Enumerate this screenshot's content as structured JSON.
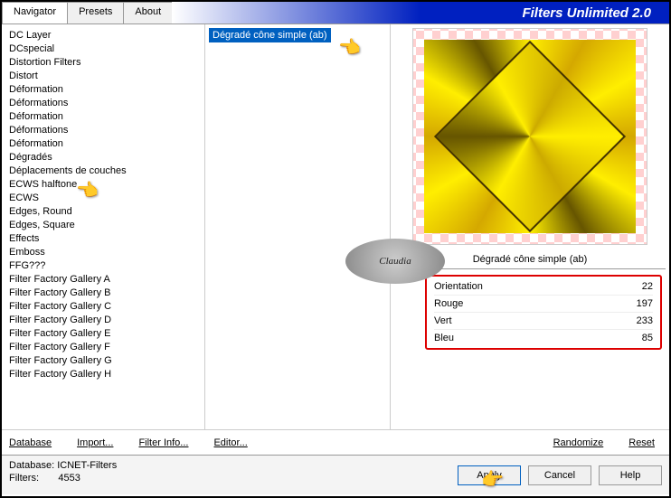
{
  "title": "Filters Unlimited 2.0",
  "tabs": {
    "navigator": "Navigator",
    "presets": "Presets",
    "about": "About"
  },
  "sidebar": {
    "items": [
      "DC Layer",
      "DCspecial",
      "Distortion Filters",
      "Distort",
      "Déformation",
      "Déformations",
      "Déformation",
      "Déformations",
      "Déformation",
      "Dégradés",
      "Déplacements de couches",
      "ECWS halftone",
      "ECWS",
      "Edges, Round",
      "Edges, Square",
      "Effects",
      "Emboss",
      "FFG???",
      "Filter Factory Gallery A",
      "Filter Factory Gallery B",
      "Filter Factory Gallery C",
      "Filter Factory Gallery D",
      "Filter Factory Gallery E",
      "Filter Factory Gallery F",
      "Filter Factory Gallery G",
      "Filter Factory Gallery H"
    ]
  },
  "filter_list": {
    "selected": "Dégradé cône simple (ab)"
  },
  "preview": {
    "title": "Dégradé cône simple (ab)"
  },
  "params": {
    "p0": {
      "name": "Orientation",
      "value": "22"
    },
    "p1": {
      "name": "Rouge",
      "value": "197"
    },
    "p2": {
      "name": "Vert",
      "value": "233"
    },
    "p3": {
      "name": "Bleu",
      "value": "85"
    }
  },
  "buttons1": {
    "database": "Database",
    "import": "Import...",
    "filterinfo": "Filter Info...",
    "editor": "Editor...",
    "randomize": "Randomize",
    "reset": "Reset"
  },
  "status": {
    "db_label": "Database:",
    "db_value": "ICNET-Filters",
    "filters_label": "Filters:",
    "filters_value": "4553"
  },
  "buttons2": {
    "apply": "Apply",
    "cancel": "Cancel",
    "help": "Help"
  },
  "watermark": "Claudia"
}
